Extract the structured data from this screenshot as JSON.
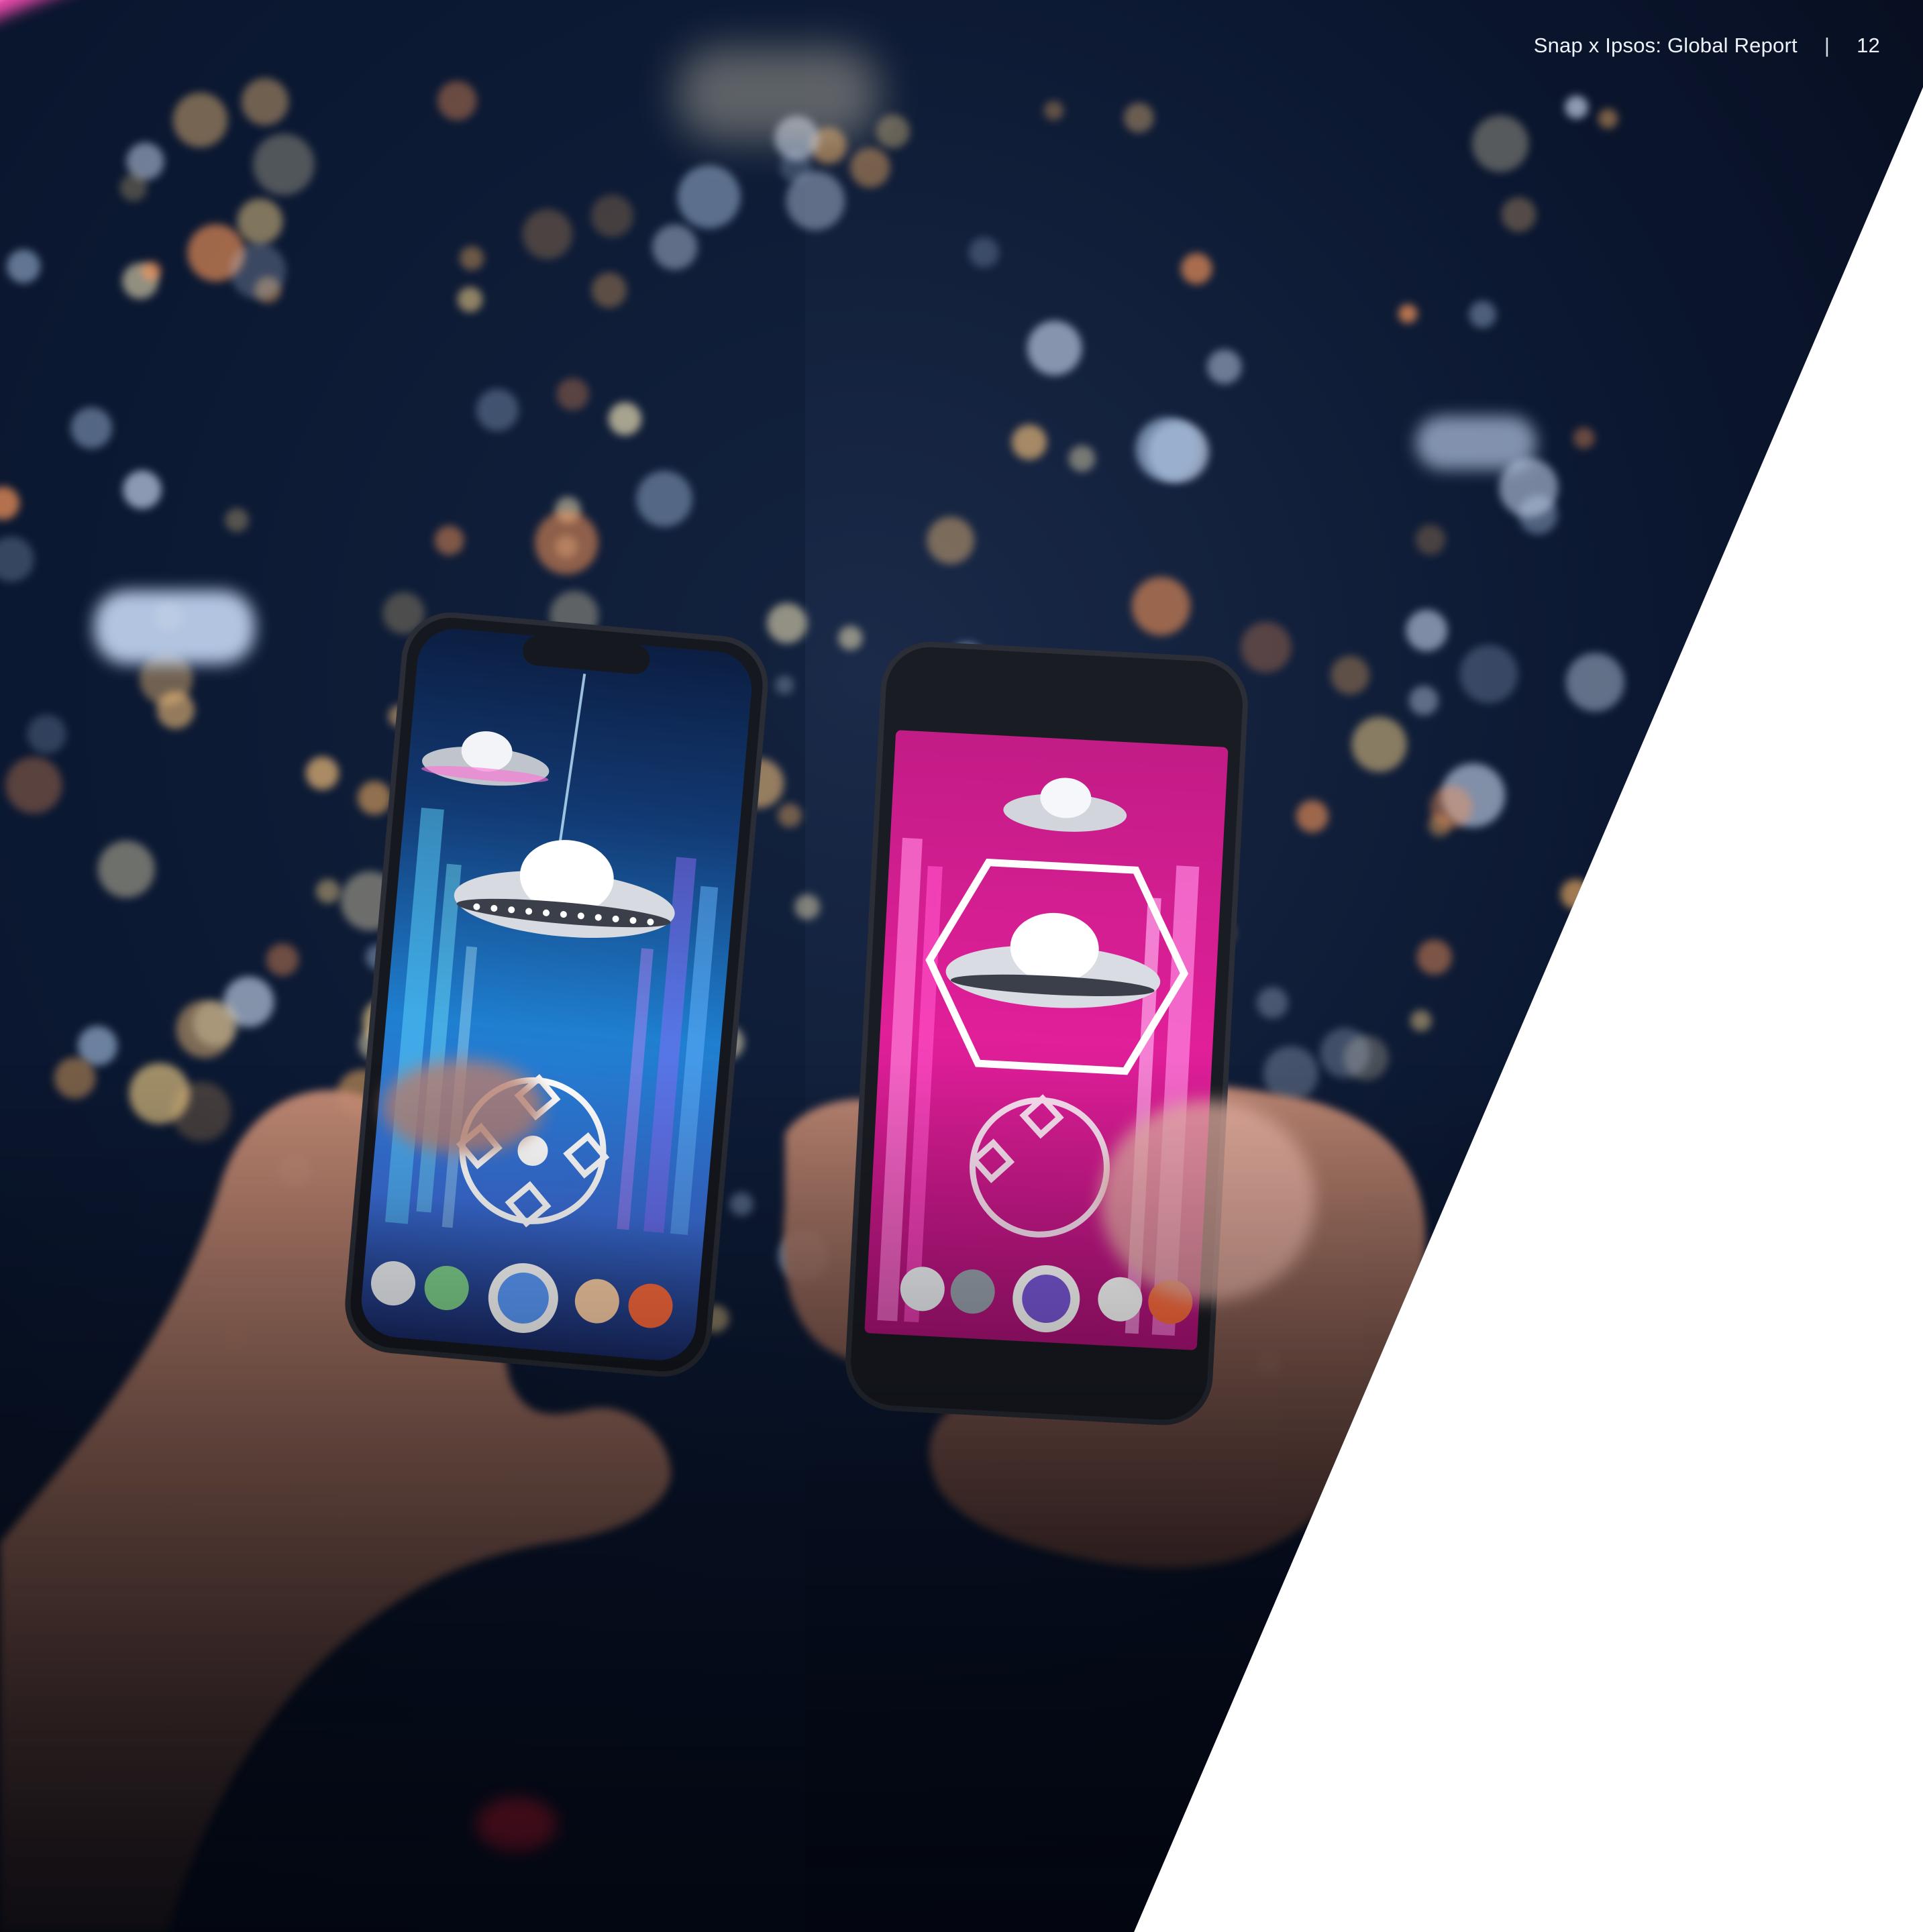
{
  "header": {
    "report_title": "Snap x Ipsos: Global Report",
    "separator": "|",
    "page_number": "12"
  },
  "colors": {
    "night_sky": "#0a1730",
    "panel_white": "#ffffff",
    "neon_pink": "#ff3fae",
    "screen_blue": "#3fb4ff",
    "screen_magenta": "#d4148f",
    "header_text": "#eef2f8"
  },
  "photo": {
    "icons": [
      "ufo-icon",
      "game-controller-icon",
      "hexagon-icon",
      "lens-carousel-icon"
    ]
  }
}
